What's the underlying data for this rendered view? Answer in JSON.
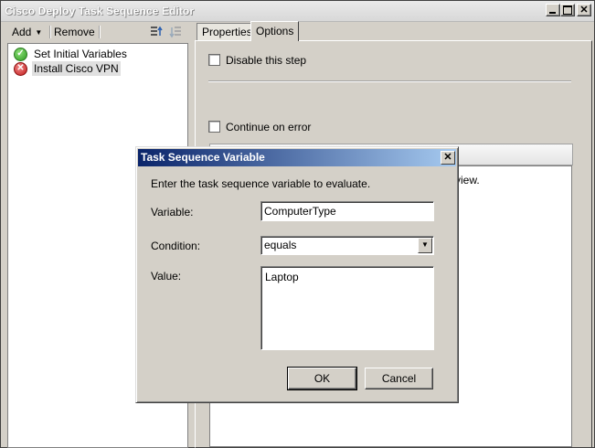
{
  "window": {
    "title": "Cisco Deploy Task Sequence Editor"
  },
  "toolbar": {
    "add_label": "Add",
    "remove_label": "Remove"
  },
  "tree": {
    "items": [
      {
        "label": "Set Initial Variables",
        "status": "success",
        "icon": "check-circle-icon"
      },
      {
        "label": "Install Cisco VPN",
        "status": "error",
        "icon": "error-circle-icon",
        "selected": true
      }
    ]
  },
  "tabs": [
    {
      "label": "Properties"
    },
    {
      "label": "Options",
      "active": true
    }
  ],
  "options": {
    "disable_step_label": "Disable this step",
    "continue_on_error_label": "Continue on error",
    "conditions_partial_text": "view."
  },
  "dialog": {
    "title": "Task Sequence Variable",
    "prompt": "Enter the task sequence variable to evaluate.",
    "variable_label": "Variable:",
    "variable_value": "ComputerType",
    "condition_label": "Condition:",
    "condition_value": "equals",
    "value_label": "Value:",
    "value_value": "Laptop",
    "ok_label": "OK",
    "cancel_label": "Cancel"
  },
  "colors": {
    "dialog_title_start": "#0a246a",
    "dialog_title_end": "#a6caf0",
    "success": "#2b9a1e",
    "error": "#c01818"
  }
}
